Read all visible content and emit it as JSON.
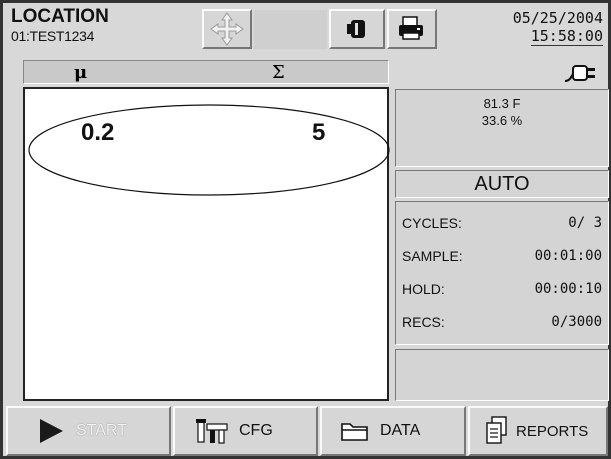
{
  "header": {
    "title": "LOCATION",
    "location_id": "01:TEST1234",
    "move_icon": "move-arrows-icon",
    "sensor_icon": "sensor-icon",
    "print_icon": "printer-icon",
    "date": "05/25/2004",
    "time": "15:58:00"
  },
  "columns": {
    "mean": "μ",
    "sum": "Σ"
  },
  "power_icon": "power-plug-icon",
  "readings": {
    "mean_value": "0.2",
    "sum_value": "5"
  },
  "environment": {
    "temperature": "81.3 F",
    "humidity": "33.6 %"
  },
  "mode": "AUTO",
  "stats": {
    "cycles_label": "CYCLES:",
    "cycles_value": "0/ 3",
    "sample_label": "SAMPLE:",
    "sample_value": "00:01:00",
    "hold_label": "HOLD:",
    "hold_value": "00:00:10",
    "recs_label": "RECS:",
    "recs_value": "0/3000"
  },
  "bottom": {
    "start_label": "START",
    "cfg_label": "CFG",
    "data_label": "DATA",
    "reports_label": "REPORTS"
  }
}
